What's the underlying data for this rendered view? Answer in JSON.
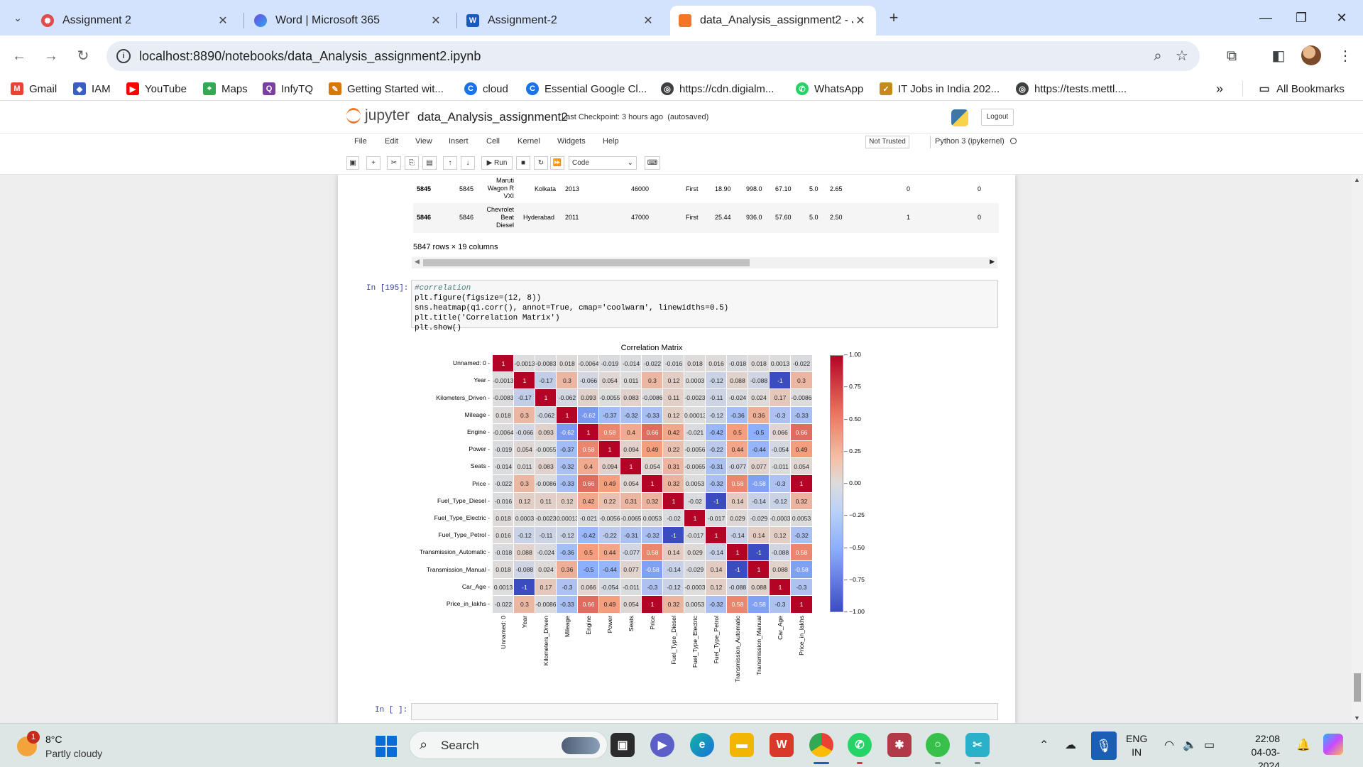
{
  "browser": {
    "tabs": [
      {
        "label": "Assignment 2",
        "icon": "gear-red-icon",
        "active": false
      },
      {
        "label": "Word | Microsoft 365",
        "icon": "m365-icon",
        "active": false
      },
      {
        "label": "Assignment-2",
        "icon": "word-icon",
        "active": false
      },
      {
        "label": "data_Analysis_assignment2 - Ju",
        "icon": "jupyter-icon",
        "active": true
      }
    ],
    "url": "localhost:8890/notebooks/data_Analysis_assignment2.ipynb",
    "bookmarks": [
      {
        "label": "Gmail",
        "icon": "gmail-icon",
        "color": "#ea4335"
      },
      {
        "label": "IAM",
        "icon": "iam-icon",
        "color": "#3b5fc0"
      },
      {
        "label": "YouTube",
        "icon": "youtube-icon",
        "color": "#ff0000"
      },
      {
        "label": "Maps",
        "icon": "maps-icon",
        "color": "#34a853"
      },
      {
        "label": "InfyTQ",
        "icon": "infytq-icon",
        "color": "#7b3fa0"
      },
      {
        "label": "Getting Started wit...",
        "icon": "getting-started-icon",
        "color": "#d97706"
      },
      {
        "label": "cloud",
        "icon": "cloud-icon",
        "color": "#1a73e8"
      },
      {
        "label": "Essential Google Cl...",
        "icon": "google-cloud-icon",
        "color": "#1a73e8"
      },
      {
        "label": "https://cdn.digialm...",
        "icon": "globe-icon",
        "color": "#3c4043"
      },
      {
        "label": "WhatsApp",
        "icon": "whatsapp-icon",
        "color": "#25d366"
      },
      {
        "label": "IT Jobs in India 202...",
        "icon": "jobs-icon",
        "color": "#c58b1a"
      },
      {
        "label": "https://tests.mettl....",
        "icon": "globe-icon",
        "color": "#3c4043"
      }
    ],
    "all_bookmarks": "All Bookmarks"
  },
  "jupyter": {
    "logo_text": "jupyter",
    "notebook_name": "data_Analysis_assignment2",
    "checkpoint": "Last Checkpoint: 3 hours ago",
    "autosaved": "(autosaved)",
    "logout": "Logout",
    "menu": [
      "File",
      "Edit",
      "View",
      "Insert",
      "Cell",
      "Kernel",
      "Widgets",
      "Help"
    ],
    "not_trusted": "Not Trusted",
    "kernel": "Python 3 (ipykernel)",
    "run_label": "Run",
    "cell_type": "Code"
  },
  "dataframe": {
    "rows": [
      {
        "idx": "5845",
        "c1": "5845",
        "car": "Maruti\nWagon R\nVXI",
        "loc": "Kolkata",
        "year": "2013",
        "km": "46000",
        "owner": "First",
        "mileage": "18.90",
        "engine": "998.0",
        "power": "67.10",
        "seats": "5.0",
        "price": "2.65",
        "d1": "0",
        "d2": "0"
      },
      {
        "idx": "5846",
        "c1": "5846",
        "car": "Chevrolet\nBeat\nDiesel",
        "loc": "Hyderabad",
        "year": "2011",
        "km": "47000",
        "owner": "First",
        "mileage": "25.44",
        "engine": "936.0",
        "power": "57.60",
        "seats": "5.0",
        "price": "2.50",
        "d1": "1",
        "d2": "0"
      }
    ],
    "shape": "5847 rows × 19 columns"
  },
  "cell": {
    "prompt": "In [195]:",
    "empty_prompt": "In [ ]:",
    "code": [
      "#correlation",
      "plt.figure(figsize=(12, 8))",
      "sns.heatmap(q1.corr(), annot=True, cmap='coolwarm', linewidths=0.5)",
      "plt.title('Correlation Matrix')",
      "plt.show()"
    ]
  },
  "chart_data": {
    "type": "heatmap",
    "title": "Correlation Matrix",
    "cmap": "coolwarm",
    "colorbar_ticks": [
      "1.00",
      "0.75",
      "0.50",
      "0.25",
      "0.00",
      "−0.25",
      "−0.50",
      "−0.75",
      "−1.00"
    ],
    "vmin": -1,
    "vmax": 1,
    "labels": [
      "Unnamed: 0",
      "Year",
      "Kilometers_Driven",
      "Mileage",
      "Engine",
      "Power",
      "Seats",
      "Price",
      "Fuel_Type_Diesel",
      "Fuel_Type_Electric",
      "Fuel_Type_Petrol",
      "Transmission_Automatic",
      "Transmission_Manual",
      "Car_Age",
      "Price_in_lakhs"
    ],
    "matrix": [
      [
        1,
        -0.0013,
        -0.0083,
        0.018,
        -0.0064,
        -0.019,
        -0.014,
        -0.022,
        -0.016,
        0.018,
        0.016,
        -0.018,
        0.018,
        0.0013,
        -0.022
      ],
      [
        -0.0013,
        1,
        -0.17,
        0.3,
        -0.066,
        0.054,
        0.011,
        0.3,
        0.12,
        0.0003,
        -0.12,
        0.088,
        -0.088,
        -1,
        0.3
      ],
      [
        -0.0083,
        -0.17,
        1,
        -0.062,
        0.093,
        -0.0055,
        0.083,
        -0.0086,
        0.11,
        -0.0023,
        -0.11,
        -0.024,
        0.024,
        0.17,
        -0.0086
      ],
      [
        0.018,
        0.3,
        -0.062,
        1,
        -0.62,
        -0.37,
        -0.32,
        -0.33,
        0.12,
        0.00013,
        -0.12,
        -0.36,
        0.36,
        -0.3,
        -0.33
      ],
      [
        -0.0064,
        -0.066,
        0.093,
        -0.62,
        1,
        0.58,
        0.4,
        0.66,
        0.42,
        -0.021,
        -0.42,
        0.5,
        -0.5,
        0.066,
        0.66
      ],
      [
        -0.019,
        0.054,
        -0.0055,
        -0.37,
        0.58,
        1,
        0.094,
        0.49,
        0.22,
        -0.0056,
        -0.22,
        0.44,
        -0.44,
        -0.054,
        0.49
      ],
      [
        -0.014,
        0.011,
        0.083,
        -0.32,
        0.4,
        0.094,
        1,
        0.054,
        0.31,
        -0.0065,
        -0.31,
        -0.077,
        0.077,
        -0.011,
        0.054
      ],
      [
        -0.022,
        0.3,
        -0.0086,
        -0.33,
        0.66,
        0.49,
        0.054,
        1,
        0.32,
        0.0053,
        -0.32,
        0.58,
        -0.58,
        -0.3,
        1
      ],
      [
        -0.016,
        0.12,
        0.11,
        0.12,
        0.42,
        0.22,
        0.31,
        0.32,
        1,
        -0.02,
        -1,
        0.14,
        -0.14,
        -0.12,
        0.32
      ],
      [
        0.018,
        0.0003,
        -0.0023,
        0.00013,
        -0.021,
        -0.0056,
        -0.0065,
        0.0053,
        -0.02,
        1,
        -0.017,
        0.029,
        -0.029,
        -0.0003,
        0.0053
      ],
      [
        0.016,
        -0.12,
        -0.11,
        -0.12,
        -0.42,
        -0.22,
        -0.31,
        -0.32,
        -1,
        -0.017,
        1,
        -0.14,
        0.14,
        0.12,
        -0.32
      ],
      [
        -0.018,
        0.088,
        -0.024,
        -0.36,
        0.5,
        0.44,
        -0.077,
        0.58,
        0.14,
        0.029,
        -0.14,
        1,
        -1,
        -0.088,
        0.58
      ],
      [
        0.018,
        -0.088,
        0.024,
        0.36,
        -0.5,
        -0.44,
        0.077,
        -0.58,
        -0.14,
        -0.029,
        0.14,
        -1,
        1,
        0.088,
        -0.58
      ],
      [
        0.0013,
        -1,
        0.17,
        -0.3,
        0.066,
        -0.054,
        -0.011,
        -0.3,
        -0.12,
        -0.0003,
        0.12,
        -0.088,
        0.088,
        1,
        -0.3
      ],
      [
        -0.022,
        0.3,
        -0.0086,
        -0.33,
        0.66,
        0.49,
        0.054,
        1,
        0.32,
        0.0053,
        -0.32,
        0.58,
        -0.58,
        -0.3,
        1
      ]
    ]
  },
  "taskbar": {
    "temperature": "8°C",
    "condition": "Partly cloudy",
    "weather_badge": "1",
    "search": "Search",
    "lang_top": "ENG",
    "lang_bottom": "IN",
    "time": "22:08",
    "date": "04-03-2024"
  }
}
